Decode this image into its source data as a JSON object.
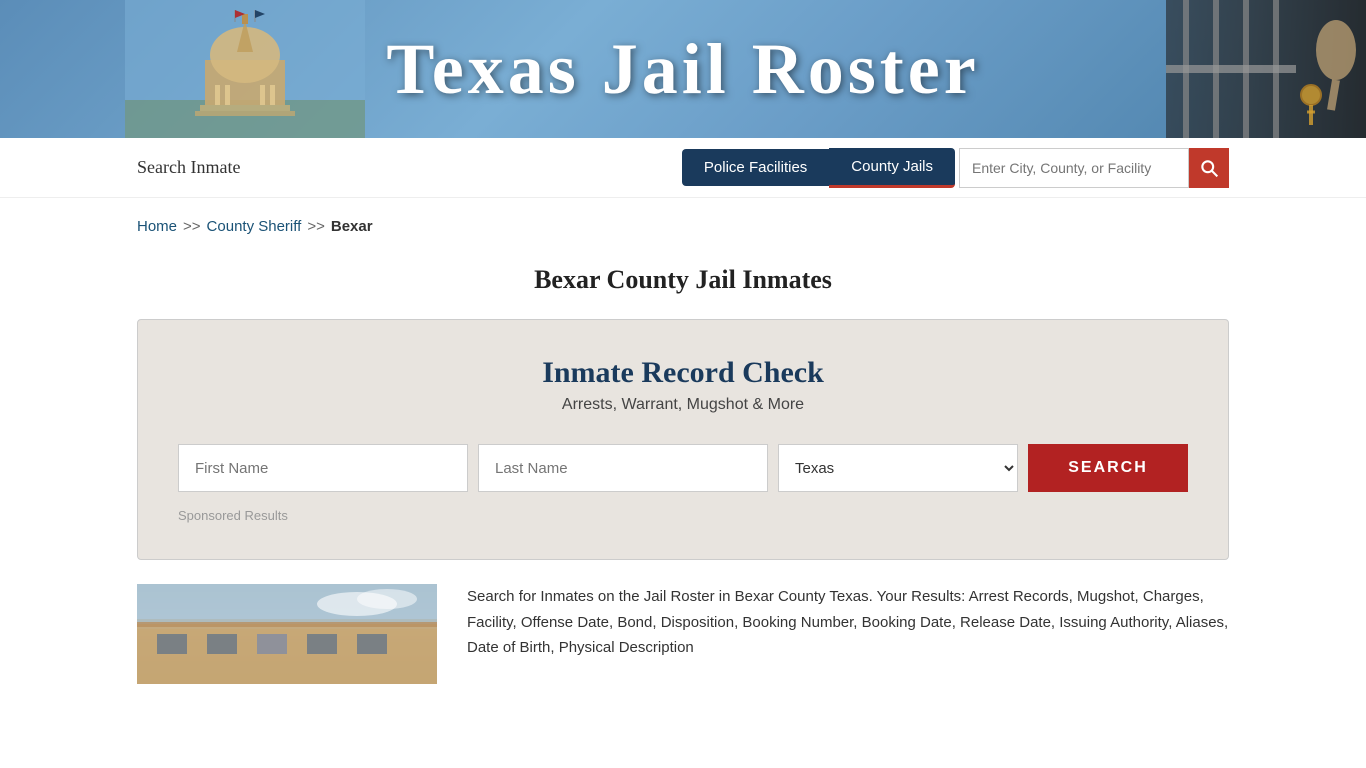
{
  "header": {
    "banner_title": "Texas Jail Roster",
    "site_url": "/"
  },
  "nav": {
    "search_inmate_label": "Search Inmate",
    "tab_police": "Police Facilities",
    "tab_county": "County Jails",
    "search_placeholder": "Enter City, County, or Facility"
  },
  "breadcrumb": {
    "home": "Home",
    "separator1": ">>",
    "county_sheriff": "County Sheriff",
    "separator2": ">>",
    "current": "Bexar"
  },
  "page_title": "Bexar County Jail Inmates",
  "record_check": {
    "title": "Inmate Record Check",
    "subtitle": "Arrests, Warrant, Mugshot & More",
    "first_name_placeholder": "First Name",
    "last_name_placeholder": "Last Name",
    "state_default": "Texas",
    "search_btn": "SEARCH",
    "sponsored_label": "Sponsored Results"
  },
  "description": {
    "text": "Search for Inmates on the Jail Roster in Bexar County Texas. Your Results: Arrest Records, Mugshot, Charges, Facility, Offense Date, Bond, Disposition, Booking Number, Booking Date, Release Date, Issuing Authority, Aliases, Date of Birth, Physical Description"
  },
  "colors": {
    "nav_dark": "#1a3a5c",
    "search_btn_red": "#c0392b",
    "record_search_btn_red": "#b22222",
    "link_blue": "#1a5276",
    "box_bg": "#e8e4df"
  }
}
